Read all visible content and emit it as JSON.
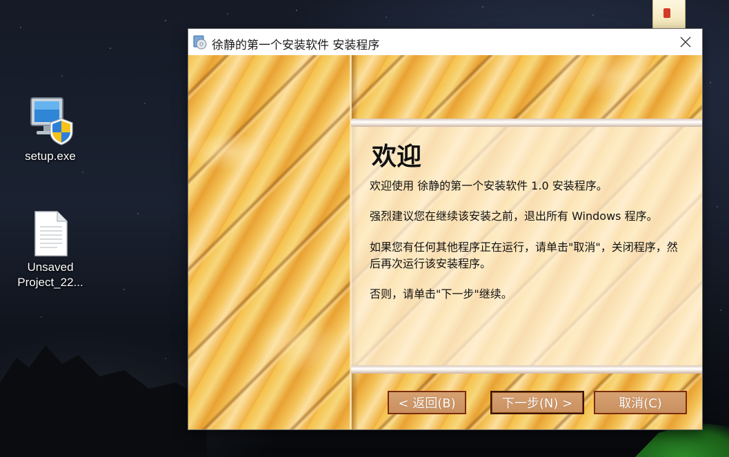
{
  "desktop": {
    "icons": [
      {
        "label": "setup.exe",
        "icon": "installer-monitor-shield-icon"
      },
      {
        "label": "Unsaved\nProject_22...",
        "label_line1": "Unsaved",
        "label_line2": "Project_22...",
        "icon": "document-icon"
      }
    ],
    "partial_icon": "folder-icon"
  },
  "window": {
    "title": "徐静的第一个安装软件 安装程序",
    "app_icon": "installer-disc-icon",
    "close_icon": "close-icon"
  },
  "wizard": {
    "heading": "欢迎",
    "paragraphs": [
      "欢迎使用 徐静的第一个安装软件 1.0 安装程序。",
      "强烈建议您在继续该安装之前，退出所有 Windows 程序。",
      "如果您有任何其他程序正在运行，请单击\"取消\"，关闭程序，然后再次运行该安装程序。",
      "否则，请单击\"下一步\"继续。"
    ]
  },
  "buttons": {
    "back": "< 返回(B)",
    "next": "下一步(N) >",
    "cancel": "取消(C)"
  },
  "colors": {
    "button_border": "#7a2b08",
    "button_fill": "#c98f5f",
    "wood": "#f2b440"
  }
}
